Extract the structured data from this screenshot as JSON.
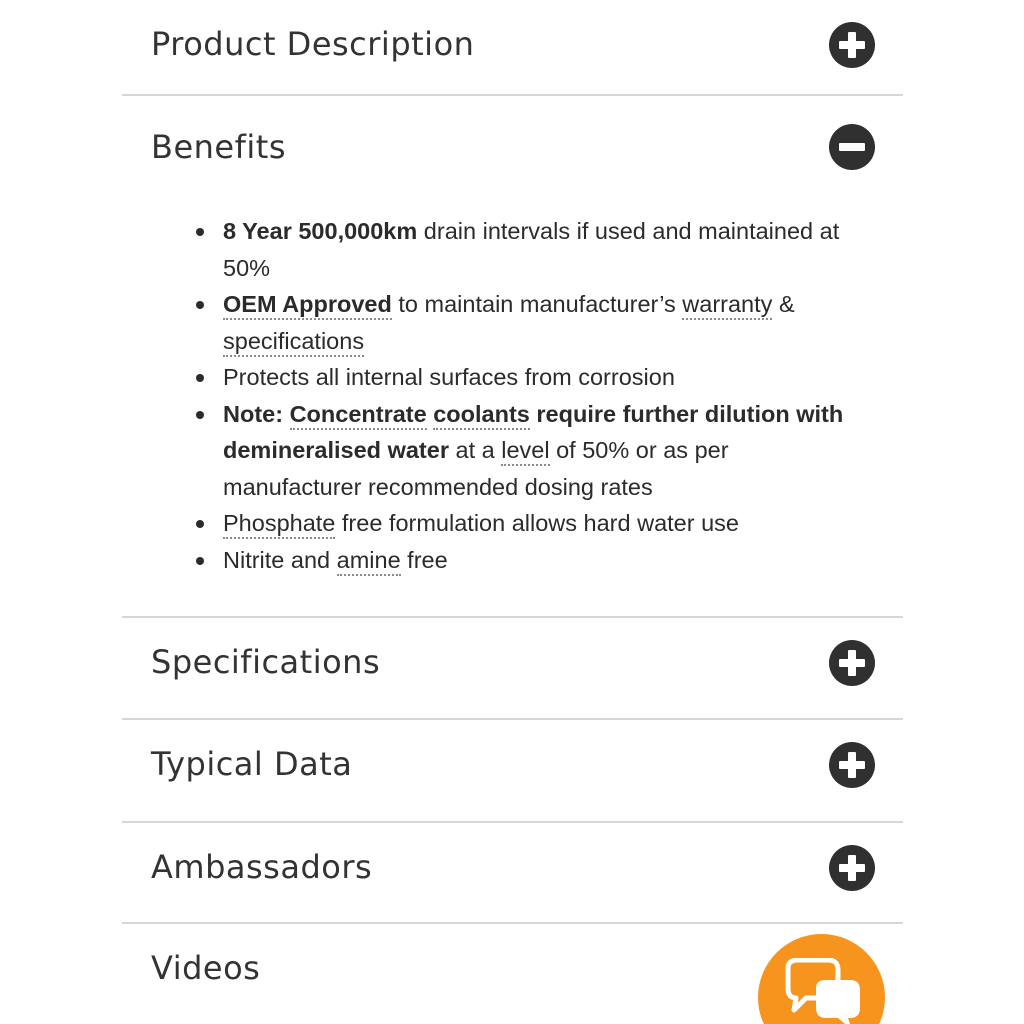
{
  "accordion": {
    "sections": [
      {
        "title": "Product Description",
        "state": "collapsed",
        "toggle_icon": "plus-circle-icon"
      },
      {
        "title": "Benefits",
        "state": "expanded",
        "toggle_icon": "minus-circle-icon"
      },
      {
        "title": "Specifications",
        "state": "collapsed",
        "toggle_icon": "plus-circle-icon"
      },
      {
        "title": "Typical Data",
        "state": "collapsed",
        "toggle_icon": "plus-circle-icon"
      },
      {
        "title": "Ambassadors",
        "state": "collapsed",
        "toggle_icon": "plus-circle-icon"
      },
      {
        "title": "Videos",
        "state": "collapsed"
      }
    ]
  },
  "benefits": {
    "item1": {
      "bold": "8 Year 500,000km",
      "rest": " drain intervals if used and maintained at 50%"
    },
    "item2": {
      "bold_link": "OEM Approved",
      "mid": " to maintain manufacturer’s ",
      "link": "warranty",
      "amp": " & ",
      "link2": "specifications"
    },
    "item3": {
      "text": "Protects all internal surfaces from corrosion"
    },
    "item4": {
      "note": "Note: ",
      "link1": "Concentrate",
      "space": " ",
      "link2": "coolants",
      "bold_rest": " require further dilution with demineralised water",
      "mid": " at a ",
      "link3": "level",
      "rest": " of 50% or as per manufacturer recommended dosing rates"
    },
    "item5": {
      "link": "Phosphate",
      "rest": " free formulation allows hard water use"
    },
    "item6": {
      "text": "Nitrite and ",
      "link": "amine",
      "rest": " free"
    }
  },
  "chat": {
    "icon": "chat-bubbles-icon",
    "color": "#f7941d"
  },
  "colors": {
    "toggle": "#303030",
    "divider": "#d6d6d6",
    "text": "#333333",
    "accent": "#f7941d"
  }
}
